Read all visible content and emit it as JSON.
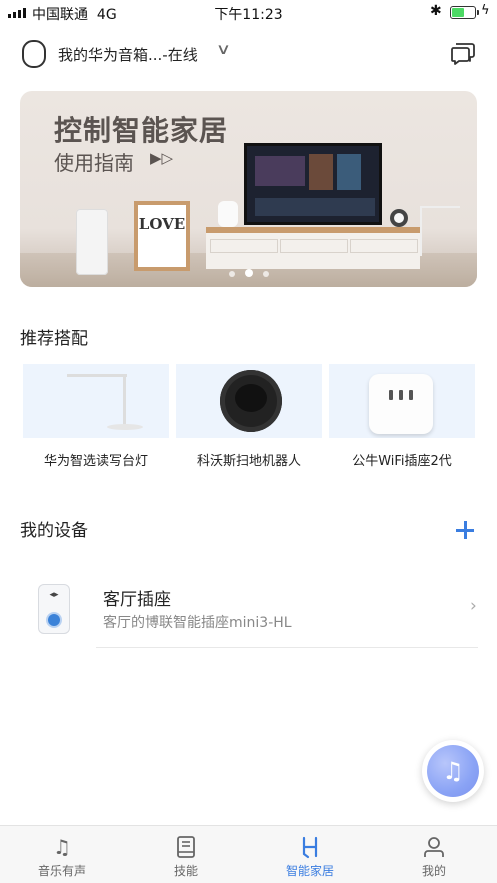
{
  "status_bar": {
    "carrier": "中国联通",
    "network": "4G",
    "time": "下午11:23",
    "battery_level": 0.55
  },
  "header": {
    "device_title": "我的华为音箱...-在线"
  },
  "banner": {
    "title": "控制智能家居",
    "subtitle": "使用指南",
    "play_glyph": "▶▷",
    "frame_text": "LOVE",
    "page_count": 3,
    "active_page": 2
  },
  "recommend": {
    "title": "推荐搭配",
    "items": [
      {
        "label": "华为智选读写台灯",
        "icon": "desk-lamp"
      },
      {
        "label": "科沃斯扫地机器人",
        "icon": "robot-vacuum"
      },
      {
        "label": "公牛WiFi插座2代",
        "icon": "smart-plug"
      }
    ]
  },
  "my_devices": {
    "title": "我的设备",
    "devices": [
      {
        "name": "客厅插座",
        "desc": "客厅的博联智能插座mini3-HL"
      }
    ]
  },
  "tabbar": {
    "tabs": [
      {
        "label": "音乐有声",
        "icon": "music-note"
      },
      {
        "label": "技能",
        "icon": "book"
      },
      {
        "label": "智能家居",
        "icon": "smart-home",
        "active": true
      },
      {
        "label": "我的",
        "icon": "user"
      }
    ]
  },
  "colors": {
    "accent": "#3a7de0",
    "banner_text": "#5b5451",
    "card_bg": "#edf4fd"
  }
}
